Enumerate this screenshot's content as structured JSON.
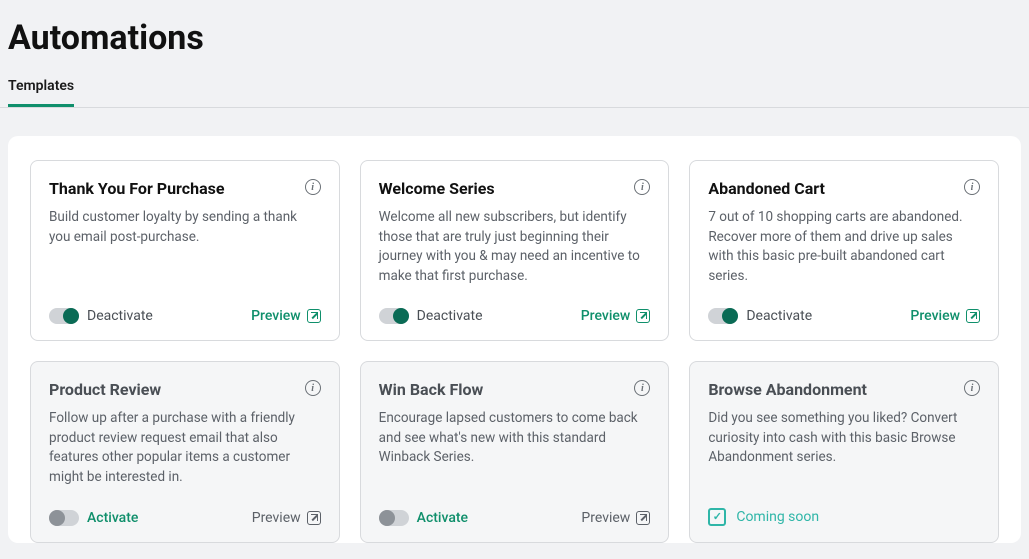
{
  "page": {
    "title": "Automations"
  },
  "tabs": [
    {
      "label": "Templates",
      "active": true
    }
  ],
  "cards": [
    {
      "title": "Thank You For Purchase",
      "description": "Build customer loyalty by sending a thank you email post-purchase.",
      "active": true,
      "toggle_label": "Deactivate",
      "preview_label": "Preview",
      "status": "active"
    },
    {
      "title": "Welcome Series",
      "description": "Welcome all new subscribers, but identify those that are truly just beginning their journey with you & may need an incentive to make that first purchase.",
      "active": true,
      "toggle_label": "Deactivate",
      "preview_label": "Preview",
      "status": "active"
    },
    {
      "title": "Abandoned Cart",
      "description": "7 out of 10 shopping carts are abandoned. Recover more of them and drive up sales with this basic pre-built abandoned cart series.",
      "active": true,
      "toggle_label": "Deactivate",
      "preview_label": "Preview",
      "status": "active"
    },
    {
      "title": "Product Review",
      "description": "Follow up after a purchase with a friendly product review request email that also features other popular items a customer might be interested in.",
      "active": false,
      "toggle_label": "Activate",
      "preview_label": "Preview",
      "status": "inactive"
    },
    {
      "title": "Win Back Flow",
      "description": "Encourage lapsed customers to come back and see what's new with this standard Winback Series.",
      "active": false,
      "toggle_label": "Activate",
      "preview_label": "Preview",
      "status": "inactive"
    },
    {
      "title": "Browse Abandonment",
      "description": "Did you see something you liked? Convert curiosity into cash with this basic Browse Abandonment series.",
      "active": false,
      "status": "coming_soon",
      "coming_label": "Coming soon"
    }
  ]
}
